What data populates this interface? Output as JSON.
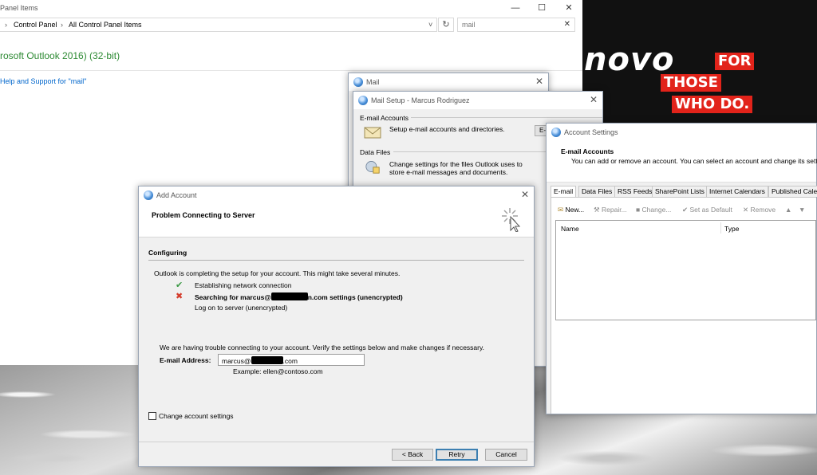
{
  "explorer": {
    "title": "Panel Items",
    "breadcrumb": [
      "Control Panel",
      "All Control Panel Items"
    ],
    "search_value": "mail",
    "result_title": "rosoft Outlook 2016) (32-bit)",
    "help_link": "Help and Support for \"mail\""
  },
  "desktop": {
    "brand_text": "novo",
    "slogan": [
      "FOR",
      "THOSE",
      "WHO DO."
    ],
    "brand_color": "#e2231a"
  },
  "mail_dialog": {
    "title": "Mail"
  },
  "mail_setup": {
    "title": "Mail Setup - Marcus Rodriguez",
    "email_group": "E-mail Accounts",
    "email_desc": "Setup e-mail accounts and directories.",
    "email_button": "E-",
    "data_group": "Data Files",
    "data_desc_1": "Change settings for the files Outlook uses to",
    "data_desc_2": "store e-mail messages and documents."
  },
  "account_settings": {
    "title": "Account Settings",
    "header_title": "E-mail Accounts",
    "header_sub": "You can add or remove an account. You can select an account and change its setti",
    "tabs": [
      "E-mail",
      "Data Files",
      "RSS Feeds",
      "SharePoint Lists",
      "Internet Calendars",
      "Published Cale"
    ],
    "toolbar": {
      "new": "New...",
      "repair": "Repair...",
      "change": "Change...",
      "default": "Set as Default",
      "remove": "Remove"
    },
    "columns": [
      "Name",
      "Type"
    ]
  },
  "add_account": {
    "title": "Add Account",
    "header": "Problem Connecting to Server",
    "section": "Configuring",
    "intro": "Outlook is completing the setup for your account. This might take several minutes.",
    "step1": "Establishing network connection",
    "step2_prefix": "Searching for marcus@",
    "step2_suffix": "n.com settings (unencrypted)",
    "step3": "Log on to server (unencrypted)",
    "trouble": "We are having trouble connecting to your account. Verify the settings below and make changes if necessary.",
    "email_label": "E-mail Address:",
    "email_prefix": "marcus@",
    "email_suffix": ".com",
    "example": "Example: ellen@contoso.com",
    "change_settings": "Change account settings",
    "back_button": "< Back",
    "retry_button": "Retry",
    "cancel_button": "Cancel",
    "status_colors": {
      "done": "#3c9a45",
      "error": "#d43c2c"
    }
  }
}
